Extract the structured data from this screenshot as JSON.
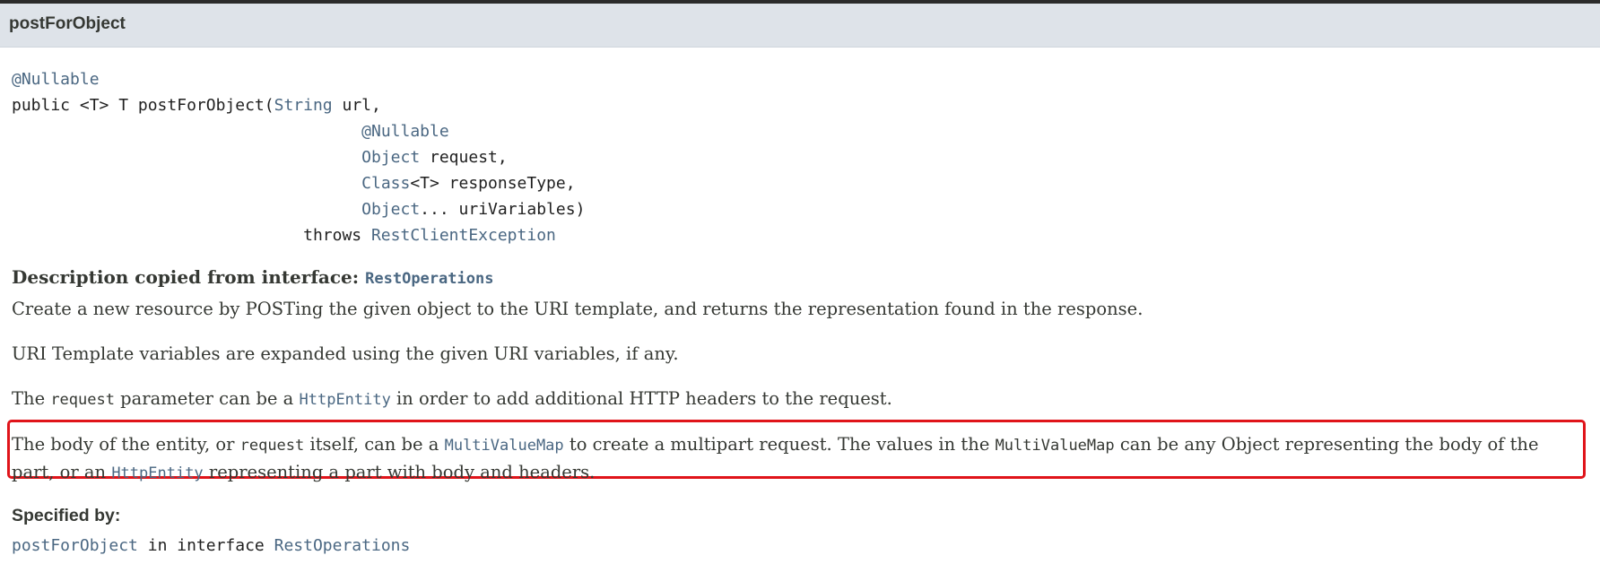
{
  "method_header": {
    "title": "postForObject"
  },
  "signature": {
    "annotation1": "@Nullable",
    "line1_prefix": "public <T> T postForObject(",
    "type_string": "String",
    "param_url": " url,",
    "annotation2": "@Nullable",
    "type_object": "Object",
    "param_request": " request,",
    "type_class": "Class",
    "param_response": "<T> responseType,",
    "type_object2": "Object",
    "param_urivars": "... uriVariables)",
    "throws_kw": "throws ",
    "exception": "RestClientException"
  },
  "description": {
    "heading": "Description copied from interface: ",
    "heading_link": "RestOperations",
    "p1": "Create a new resource by POSTing the given object to the URI template, and returns the representation found in the response.",
    "p2": "URI Template variables are expanded using the given URI variables, if any.",
    "p3_a": "The ",
    "p3_code": "request",
    "p3_b": " parameter can be a ",
    "p3_link": "HttpEntity",
    "p3_c": " in order to add additional HTTP headers to the request.",
    "p4_a": "The body of the entity, or ",
    "p4_code": "request",
    "p4_b": " itself, can be a ",
    "p4_link1": "MultiValueMap",
    "p4_c": " to create a multipart request. The values in the ",
    "p4_code2": "MultiValueMap",
    "p4_d": " can be any Object representing the body of the part, or an ",
    "p4_link2": "HttpEntity",
    "p4_e": " representing a part with body and headers."
  },
  "specified_by": {
    "label": "Specified by:",
    "method_link": "postForObject",
    "mid": " in interface ",
    "interface_link": "RestOperations"
  }
}
